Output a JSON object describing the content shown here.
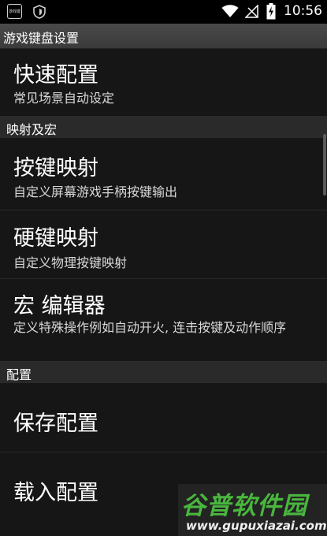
{
  "status_bar": {
    "app_icon_text": "游戏键",
    "time": "10:56",
    "icons": [
      "app-icon",
      "shield-icon",
      "wifi-icon",
      "no-signal-icon",
      "battery-charging-icon"
    ]
  },
  "title_bar": {
    "title": "游戏键盘设置"
  },
  "settings": {
    "quick_config": {
      "title": "快速配置",
      "summary": "常见场景自动设定"
    },
    "section_mapping": {
      "header": "映射及宏"
    },
    "key_mapping": {
      "title": "按键映射",
      "summary": "自定义屏幕游戏手柄按键输出"
    },
    "hard_key_mapping": {
      "title": "硬键映射",
      "summary": "自定义物理按键映射"
    },
    "macro_editor": {
      "title": "宏 编辑器",
      "summary": "定义特殊操作例如自动开火, 连击按键及动作顺序"
    },
    "section_config": {
      "header": "配置"
    },
    "save_config": {
      "title": "保存配置"
    },
    "load_config": {
      "title": "载入配置"
    }
  },
  "watermark": {
    "logo": "谷普软件园",
    "url": "www.gupuxiazai.com"
  },
  "colors": {
    "background": "#161616",
    "status_bar": "#000000",
    "title_bar": "#444444",
    "section_header": "#2a2a2a",
    "watermark_green": "#49b63e"
  }
}
